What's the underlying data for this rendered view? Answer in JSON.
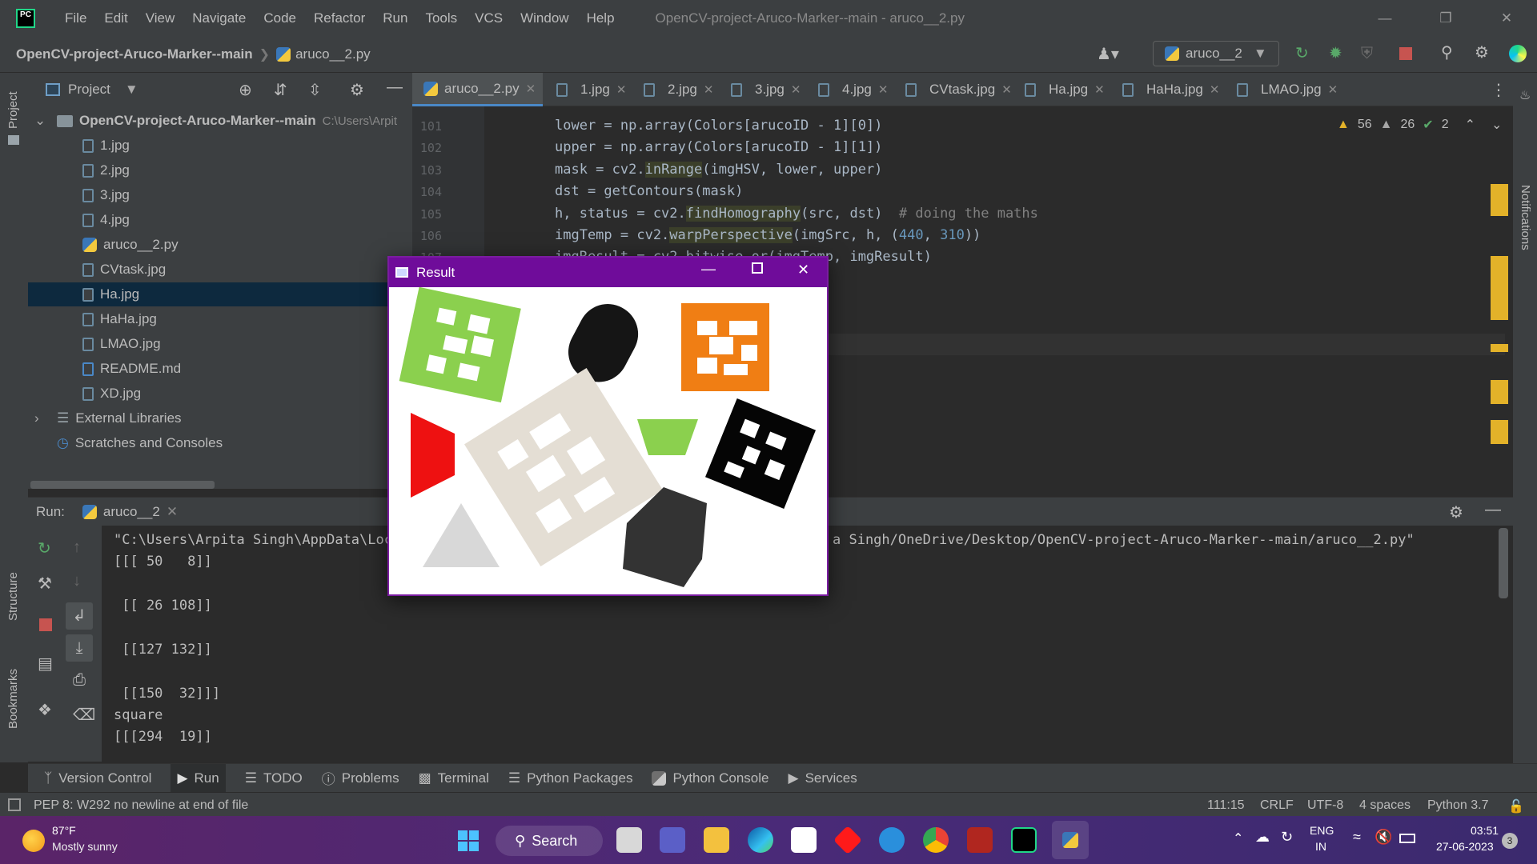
{
  "menubar": {
    "items": [
      "File",
      "Edit",
      "View",
      "Navigate",
      "Code",
      "Refactor",
      "Run",
      "Tools",
      "VCS",
      "Window",
      "Help"
    ],
    "window_title": "OpenCV-project-Aruco-Marker--main - aruco__2.py"
  },
  "navbar": {
    "project": "OpenCV-project-Aruco-Marker--main",
    "file": "aruco__2.py",
    "run_config": "aruco__2"
  },
  "project_panel": {
    "title": "Project",
    "root": "OpenCV-project-Aruco-Marker--main",
    "root_path": "C:\\Users\\Arpit",
    "files": [
      "1.jpg",
      "2.jpg",
      "3.jpg",
      "4.jpg",
      "aruco__2.py",
      "CVtask.jpg",
      "Ha.jpg",
      "HaHa.jpg",
      "LMAO.jpg",
      "README.md",
      "XD.jpg"
    ],
    "selected": "Ha.jpg",
    "external_libraries": "External Libraries",
    "scratches": "Scratches and Consoles"
  },
  "editor_tabs": [
    "aruco__2.py",
    "1.jpg",
    "2.jpg",
    "3.jpg",
    "4.jpg",
    "CVtask.jpg",
    "Ha.jpg",
    "HaHa.jpg",
    "LMAO.jpg"
  ],
  "inspections": {
    "warnings": "56",
    "weak_warnings": "26",
    "ok": "2"
  },
  "code_lines": [
    {
      "n": "101",
      "pre": "lower = np.array(Colors[arucoID - 1][0])"
    },
    {
      "n": "102",
      "pre": "upper = np.array(Colors[arucoID - 1][1])"
    },
    {
      "n": "103",
      "pre": "mask = cv2.",
      "fn": "inRange",
      "post": "(imgHSV, lower, upper)"
    },
    {
      "n": "104",
      "pre": "dst = getContours(mask)"
    },
    {
      "n": "105",
      "pre": "h, status = cv2.",
      "fn": "findHomography",
      "post": "(src, dst)",
      "comment": "  # doing the maths"
    },
    {
      "n": "106",
      "pre": "imgTemp = cv2.",
      "fn": "warpPerspective",
      "post": "(imgSrc, h, (",
      "n1": "440",
      "mid": ", ",
      "n2": "310",
      "end": "))"
    },
    {
      "n": "107",
      "pre": "imgResult = cv2.bitwise_or(imgTemp, imgResult)"
    }
  ],
  "run_panel": {
    "label": "Run:",
    "config": "aruco__2",
    "console": [
      "\"C:\\Users\\Arpita Singh\\AppData\\Loc",
      "[[[ 50   8]]",
      "",
      " [[ 26 108]]",
      "",
      " [[127 132]]",
      "",
      " [[150  32]]]",
      "square",
      "[[[294  19]]"
    ],
    "console_tail": "a Singh/OneDrive/Desktop/OpenCV-project-Aruco-Marker--main/aruco__2.py\""
  },
  "tool_windows": [
    "Version Control",
    "Run",
    "TODO",
    "Problems",
    "Terminal",
    "Python Packages",
    "Python Console",
    "Services"
  ],
  "statusbar": {
    "message": "PEP 8: W292 no newline at end of file",
    "position": "111:15",
    "line_sep": "CRLF",
    "encoding": "UTF-8",
    "indent": "4 spaces",
    "interpreter": "Python 3.7"
  },
  "side_labels": {
    "project": "Project",
    "structure": "Structure",
    "bookmarks": "Bookmarks",
    "notifications": "Notifications"
  },
  "result_window": {
    "title": "Result"
  },
  "taskbar": {
    "weather_temp": "87°F",
    "weather_desc": "Mostly sunny",
    "search": "Search",
    "lang1": "ENG",
    "lang2": "IN",
    "time": "03:51",
    "date": "27-06-2023",
    "badge": "3"
  }
}
